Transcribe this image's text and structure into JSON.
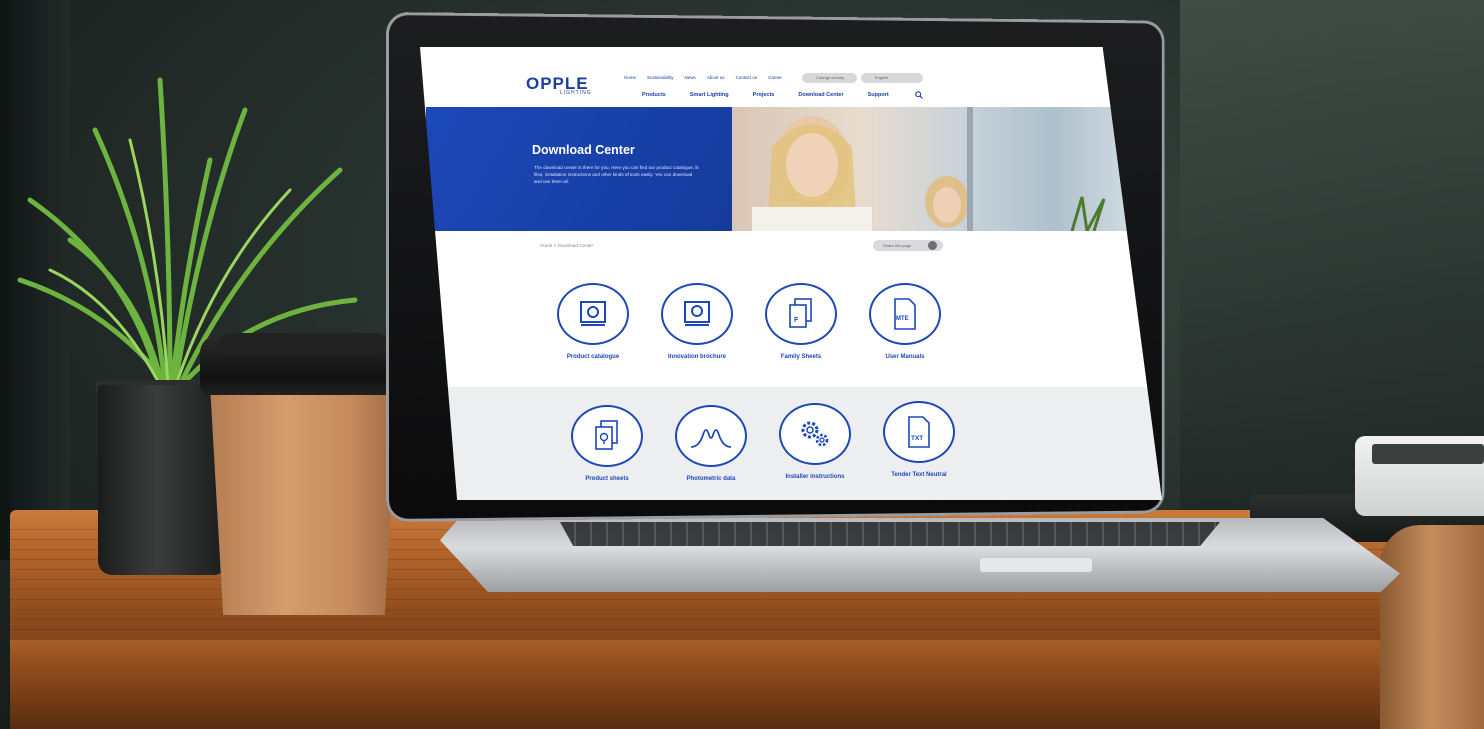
{
  "site": {
    "logo": "OPPLE",
    "logo_sub": "LIGHTING",
    "top_links": [
      "Home",
      "Sustainability",
      "News",
      "About us",
      "Contact us",
      "Career"
    ],
    "change_country": "Change country",
    "language": "English",
    "nav": [
      "Products",
      "Smart Lighting",
      "Projects",
      "Download Center",
      "Support"
    ],
    "hero_title": "Download Center",
    "hero_text": "The download center is there for you. Here you can find our product catalogue, lit files, installation instructions and other kinds of tools easily. You can download and use them all.",
    "breadcrumb": "Home  >  Download Center",
    "share": "Share this page",
    "tiles": [
      {
        "label": "Product catalogue",
        "icon": "catalogue-icon"
      },
      {
        "label": "Innovation brochure",
        "icon": "brochure-icon"
      },
      {
        "label": "Family Sheets",
        "icon": "family-sheet-icon",
        "glyph": "F"
      },
      {
        "label": "User Manuals",
        "icon": "manual-icon",
        "glyph": "MTE"
      },
      {
        "label": "Product sheets",
        "icon": "product-sheet-icon"
      },
      {
        "label": "Photometric data",
        "icon": "photometric-icon"
      },
      {
        "label": "Installer instructions",
        "icon": "gears-icon"
      },
      {
        "label": "Tender Text Neutral",
        "icon": "txt-file-icon",
        "glyph": "TXT"
      }
    ]
  },
  "colors": {
    "brand": "#1d48b8",
    "desk": "#b4662c"
  }
}
